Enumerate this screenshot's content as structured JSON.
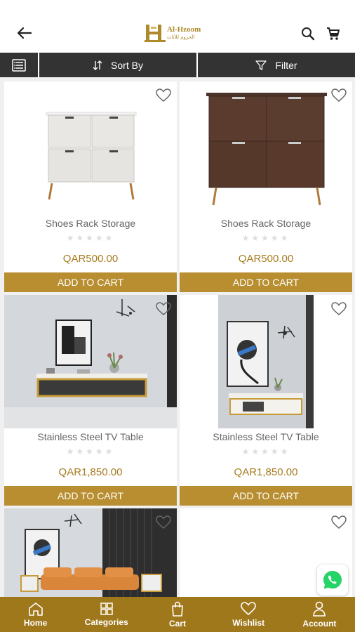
{
  "header": {
    "logo_text": "Al-Hzoom",
    "logo_subtext": "الحزوم للأثاث",
    "icons": [
      "back-arrow-icon",
      "search-icon",
      "cart-icon"
    ]
  },
  "toolbar": {
    "sort_label": "Sort By",
    "filter_label": "Filter",
    "icons": [
      "list-view-icon",
      "sort-icon",
      "filter-icon"
    ]
  },
  "products": [
    {
      "name": "Shoes Rack Storage",
      "price": "QAR500.00",
      "button": "ADD TO CART",
      "rating": "★★★★★"
    },
    {
      "name": "Shoes Rack Storage",
      "price": "QAR500.00",
      "button": "ADD TO CART",
      "rating": "★★★★★"
    },
    {
      "name": "Stainless Steel TV Table",
      "price": "QAR1,850.00",
      "button": "ADD TO CART",
      "rating": "★★★★★"
    },
    {
      "name": "Stainless Steel TV Table",
      "price": "QAR1,850.00",
      "button": "ADD TO CART",
      "rating": "★★★★★"
    },
    {
      "name": "",
      "price": "",
      "button": "",
      "rating": ""
    },
    {
      "name": "",
      "price": "",
      "button": "",
      "rating": ""
    }
  ],
  "bottom_nav": [
    {
      "label": "Home",
      "icon": "home-icon"
    },
    {
      "label": "Categories",
      "icon": "categories-icon"
    },
    {
      "label": "Cart",
      "icon": "shopping-bag-icon"
    },
    {
      "label": "Wishlist",
      "icon": "heart-icon"
    },
    {
      "label": "Account",
      "icon": "user-icon"
    }
  ],
  "colors": {
    "accent": "#b88e31",
    "nav_bg": "#a0781c",
    "toolbar_bg": "#333333",
    "price": "#a67c1e"
  }
}
